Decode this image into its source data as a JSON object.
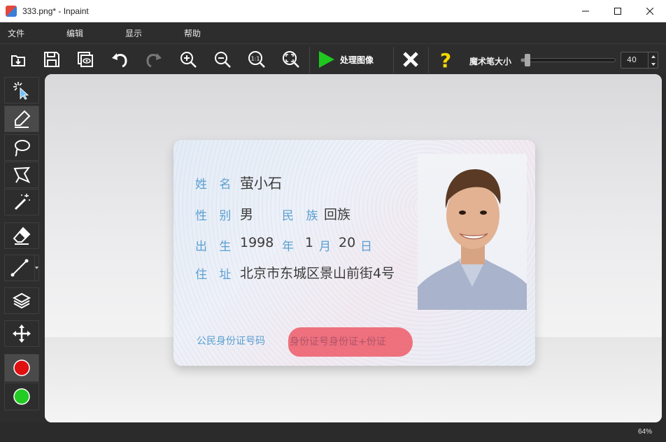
{
  "window": {
    "title": "333.png* - Inpaint",
    "app_icon": "inpaint-app-icon"
  },
  "menu": [
    "文件",
    "编辑",
    "显示",
    "帮助"
  ],
  "toolbar": {
    "icons": [
      "open-icon",
      "save-icon",
      "compare-icon",
      "undo-icon",
      "redo-icon",
      "zoom-in-icon",
      "zoom-out-icon",
      "actual-size-icon",
      "fit-window-icon",
      "play-icon",
      "close-icon",
      "help-icon"
    ],
    "process_label": "处理图像",
    "brush_size_label": "魔术笔大小",
    "brush_size_value": "40",
    "brush_size_fraction": 0.06,
    "accent_green": "#1fc81f",
    "help_color": "#f5d800"
  },
  "tools": [
    "auto-select-icon",
    "marker-icon",
    "lasso-icon",
    "polygon-lasso-icon",
    "magic-wand-icon",
    "eraser-icon",
    "line-icon",
    "layers-icon",
    "move-icon",
    "red-dot-icon",
    "green-dot-icon"
  ],
  "colors": {
    "red_marker": "#e01010",
    "green_marker": "#22cc22",
    "mask": "#ee5664"
  },
  "card": {
    "name_label": "姓 名",
    "name_value": "萤小石",
    "gender_label": "性 别",
    "gender_value": "男",
    "ethnicity_label": "民 族",
    "ethnicity_value": "回族",
    "birth_label": "出 生",
    "birth_year": "1998",
    "year_char": "年",
    "birth_month": "1",
    "month_char": "月",
    "birth_day": "20",
    "day_char": "日",
    "address_label": "住 址",
    "address_value": "北京市东城区景山前街4号",
    "id_label": "公民身份证号码",
    "id_masked_text": "身份证号身份证+份证"
  },
  "status": {
    "zoom": "64%"
  }
}
